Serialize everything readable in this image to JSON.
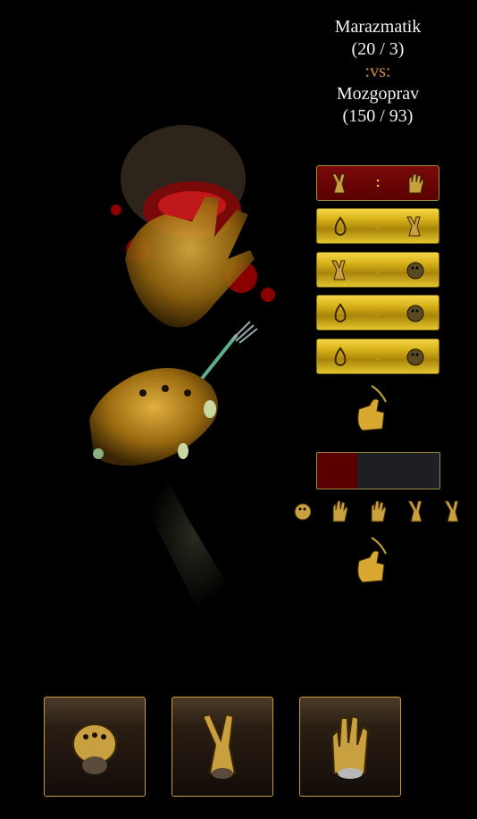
{
  "player": {
    "name": "Marazmatik",
    "score": "(20 / 3)"
  },
  "vs_label": ":vs:",
  "opponent": {
    "name": "Mozgoprav",
    "score": "(150 / 93)"
  },
  "rounds": [
    {
      "left": "victory-icon",
      "sep": ":",
      "right": "paper-icon",
      "highlight": "red"
    },
    {
      "left": "drop-icon",
      "sep": ":",
      "right": "victory-icon",
      "highlight": "gold"
    },
    {
      "left": "victory-icon",
      "sep": ":",
      "right": "rock-icon",
      "highlight": "gold"
    },
    {
      "left": "drop-icon",
      "sep": ":",
      "right": "rock-icon",
      "highlight": "gold"
    },
    {
      "left": "drop-icon",
      "sep": ":",
      "right": "rock-icon",
      "highlight": "gold"
    }
  ],
  "progress": {
    "fraction": 0.33,
    "fill_color": "#5a0000",
    "track_color": "#1e1f24"
  },
  "history_icons": [
    "rock-icon",
    "paper-icon",
    "paper-icon",
    "victory-icon",
    "victory-icon"
  ],
  "choices": [
    "rock-button",
    "scissors-button",
    "paper-button"
  ],
  "colors": {
    "accent_gold": "#d9b319",
    "vs_orange": "#d4893a",
    "round_red": "#7a0a0a"
  }
}
